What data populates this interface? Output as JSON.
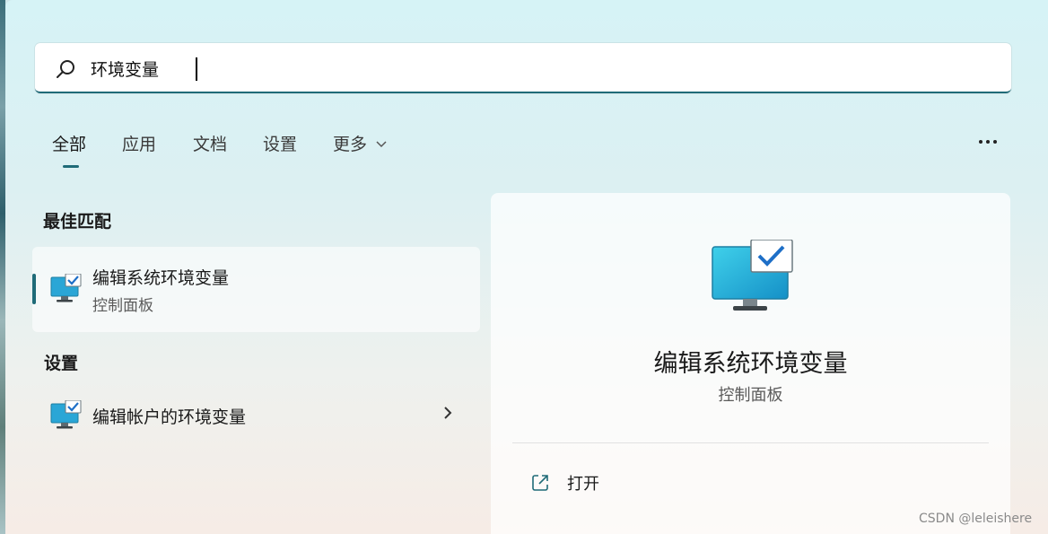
{
  "search": {
    "query": "环境变量"
  },
  "tabs": [
    {
      "label": "全部",
      "active": true
    },
    {
      "label": "应用",
      "active": false
    },
    {
      "label": "文档",
      "active": false
    },
    {
      "label": "设置",
      "active": false
    },
    {
      "label": "更多",
      "active": false
    }
  ],
  "icons": {
    "search": "search-icon",
    "more": "more-options-icon",
    "dropdown": "chevron-down-icon",
    "app": "system-monitor-checkmark-icon",
    "arrow": "chevron-right-icon",
    "open": "open-external-icon"
  },
  "best_match": {
    "heading": "最佳匹配",
    "title": "编辑系统环境变量",
    "subtitle": "控制面板"
  },
  "settings_section": {
    "heading": "设置",
    "items": [
      {
        "title": "编辑帐户的环境变量"
      }
    ]
  },
  "detail": {
    "title": "编辑系统环境变量",
    "subtitle": "控制面板",
    "actions": [
      {
        "label": "打开"
      }
    ]
  },
  "watermark": "CSDN @leleishere",
  "colors": {
    "accent": "#1f6b78",
    "monitor": "#2aa6d6"
  }
}
